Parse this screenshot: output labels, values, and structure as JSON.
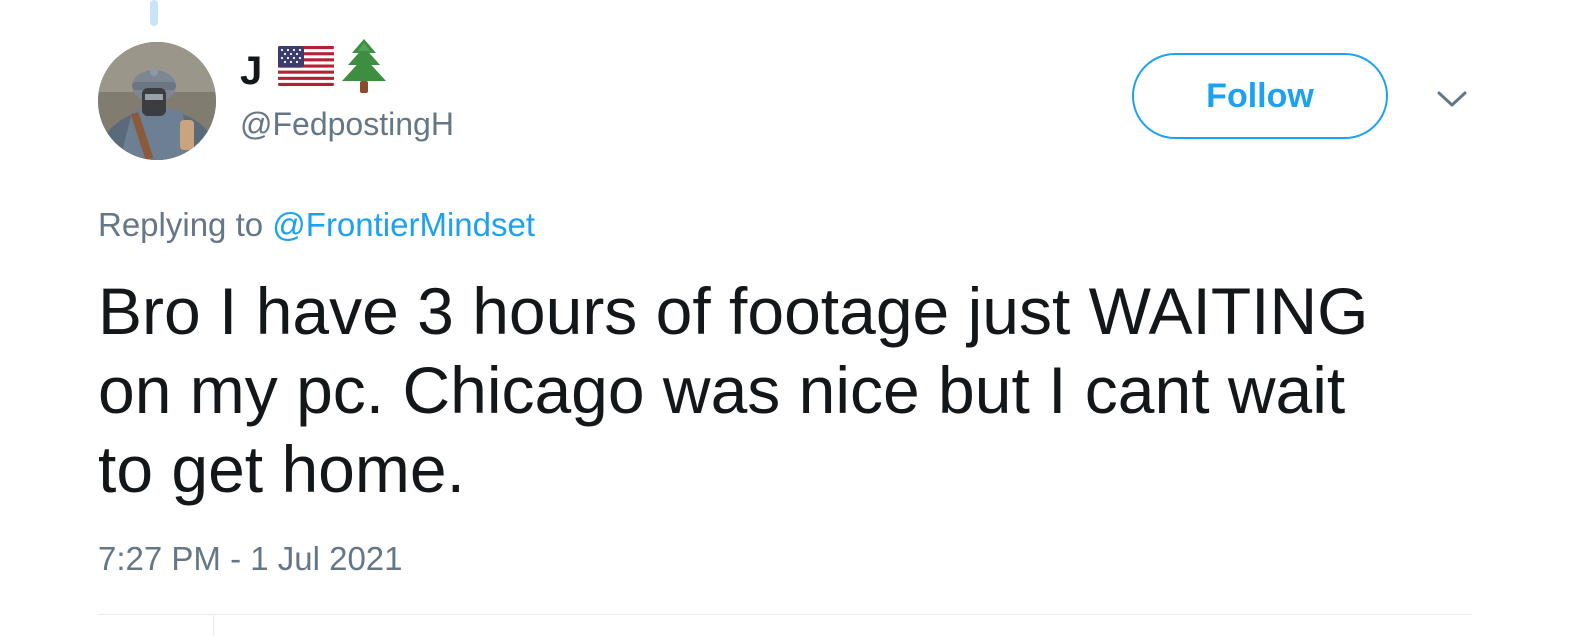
{
  "thread": {
    "has_parent_line": true,
    "line_color": "#c6e3f7"
  },
  "author": {
    "display_name": "J",
    "emojis": [
      "flag-usa-emoji",
      "evergreen-tree-emoji"
    ],
    "handle": "@FedpostingH",
    "avatar": "avatar-soldier-photo"
  },
  "actions": {
    "follow_label": "Follow",
    "more_icon": "chevron-down-icon"
  },
  "reply": {
    "prefix": "Replying to",
    "mention": "@FrontierMindset"
  },
  "tweet": {
    "lines": [
      "Bro I have 3 hours of footage just WAITING",
      "on my pc. Chicago was nice but I cant wait",
      "to get home."
    ]
  },
  "meta": {
    "timestamp": "7:27 PM - 1 Jul 2021"
  },
  "colors": {
    "accent": "#1da1f2",
    "text_primary": "#14171a",
    "text_secondary": "#657786",
    "divider": "#e6ecf0"
  }
}
